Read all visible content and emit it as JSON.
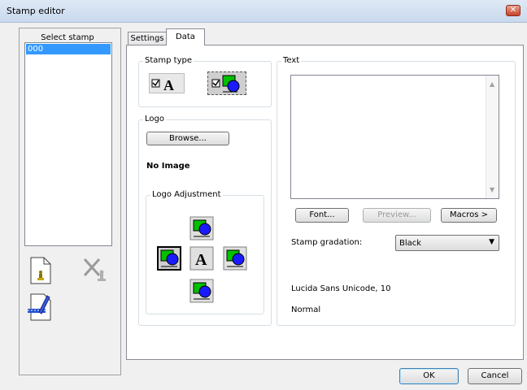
{
  "window": {
    "title": "Stamp editor",
    "close_icon": "close-x"
  },
  "left_panel": {
    "header": "Select stamp",
    "stamps": [
      "000"
    ],
    "selected_index": 0,
    "icons": {
      "new": "new-stamp-icon",
      "delete": "delete-stamp-icon",
      "edit": "edit-stamp-icon"
    }
  },
  "tabs": [
    {
      "label": "Settings",
      "active": false
    },
    {
      "label": "Data",
      "active": true
    }
  ],
  "stamp_type": {
    "legend": "Stamp type",
    "text_type_icon": "text-stamp-icon",
    "logo_type_icon": "logo-stamp-icon"
  },
  "logo": {
    "legend": "Logo",
    "browse_label": "Browse...",
    "status": "No Image",
    "adjustment": {
      "legend": "Logo Adjustment",
      "positions": [
        "top",
        "left",
        "center",
        "right",
        "bottom"
      ]
    }
  },
  "text": {
    "legend": "Text",
    "value": "",
    "font_button": "Font...",
    "preview_button": "Preview...",
    "macros_button": "Macros >"
  },
  "gradation": {
    "label": "Stamp gradation:",
    "selected": "Black"
  },
  "font_info": {
    "font": "Lucida Sans Unicode, 10",
    "style": "Normal"
  },
  "footer": {
    "ok_label": "OK",
    "cancel_label": "Cancel"
  },
  "colors": {
    "selection": "#3399ff",
    "logo_green": "#00c000",
    "logo_blue": "#1a1aff"
  }
}
